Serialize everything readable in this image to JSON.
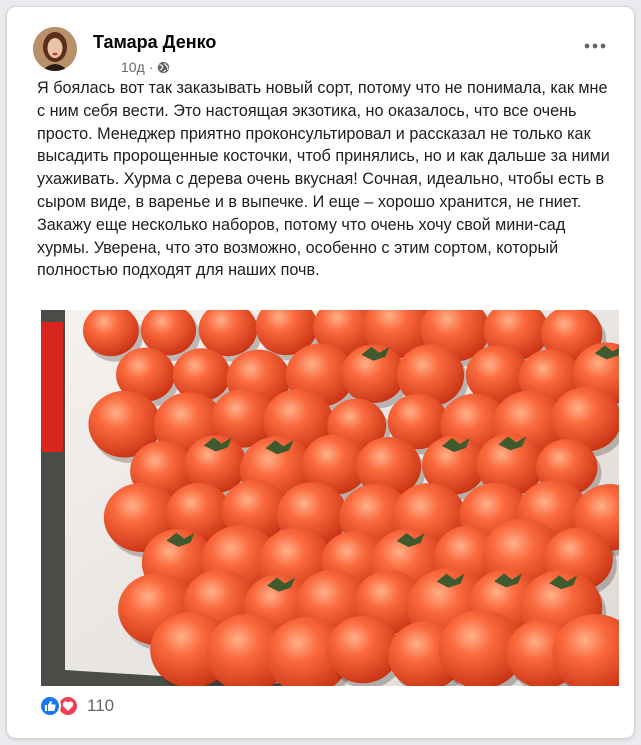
{
  "post": {
    "author": "Тамара Денко",
    "time": "10д",
    "text": "Я боялась вот так заказывать новый сорт, потому что не понимала, как мне с ним себя вести. Это настоящая экзотика, но оказалось, что все очень просто. Менеджер приятно проконсультировал и рассказал не только как высадить пророщенные косточки, чтоб принялись, но и как дальше за ними ухаживать. Хурма с дерева очень вкусная! Сочная, идеально, чтобы есть в сыром виде, в варенье и в выпечке. И еще – хорошо хранится, не гниет. Закажу еще несколько наборов, потому что очень хочу свой мини-сад хурмы. Уверена, что это возможно, особенно с этим сортом, который полностью подходят для наших почв.",
    "reaction_count": "110",
    "reactions": [
      "like-icon",
      "love-icon"
    ],
    "privacy_icon": "globe-icon"
  },
  "colors": {
    "like": "#1877f2",
    "love": "#f33e58",
    "persimmon": "#f0552a"
  }
}
